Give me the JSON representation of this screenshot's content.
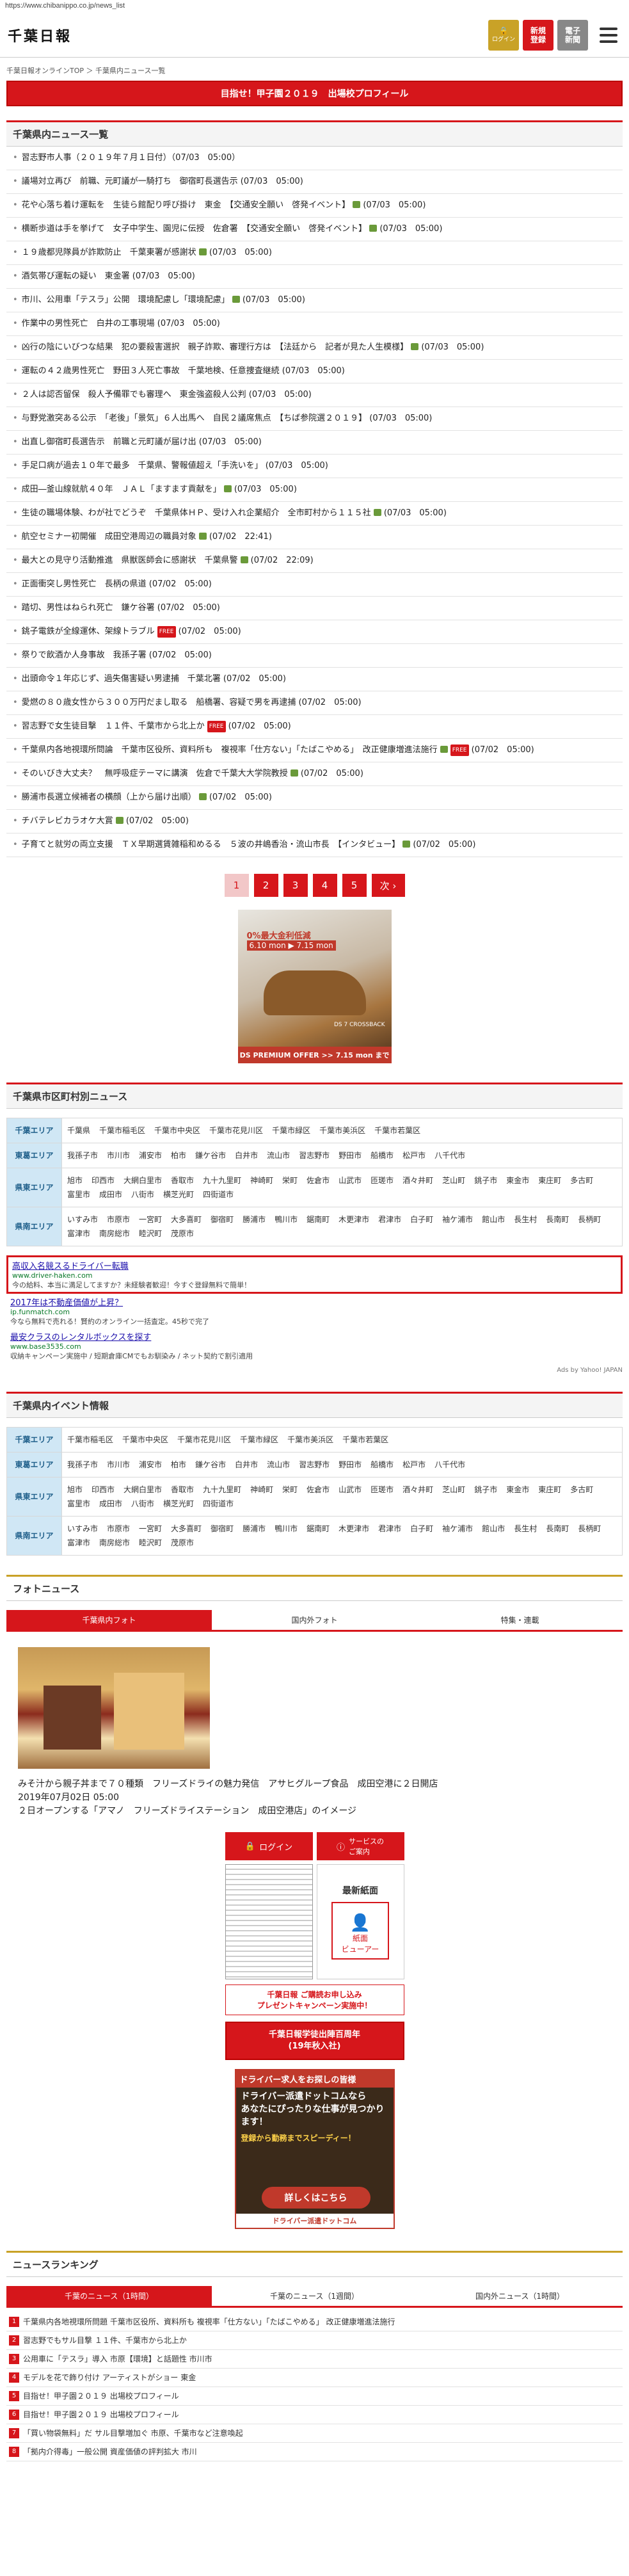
{
  "url": "https://www.chibanippo.co.jp/news_list",
  "header": {
    "logo": "千葉日報",
    "login_label": "ログイン",
    "register_label": "新規\n登録",
    "paper_label": "電子\n新聞",
    "menu_icon": "hamburger-icon"
  },
  "breadcrumb": "千葉日報オンラインTOP ＞ 千葉県内ニュース一覧",
  "banner": "目指せ！甲子園２０１９　出場校プロフィール",
  "news_section_title": "千葉県内ニュース一覧",
  "news": [
    {
      "text": "習志野市人事（２０１９年７月１日付）（07/03　05:00）",
      "cam": false,
      "free": false
    },
    {
      "text": "議場対立再び　前職、元町議が一騎打ち　御宿町長選告示 (07/03　05:00)",
      "cam": false,
      "free": false
    },
    {
      "text": "花や心落ち着け運転を　生徒ら館配り呼び掛け　東金　【交通安全願い　啓発イベント】",
      "cam": true,
      "free": false,
      "tail": "(07/03　05:00)"
    },
    {
      "text": "横断歩道は手を挙げて　女子中学生、園児に伝授　佐倉署　【交通安全願い　啓発イベント】",
      "cam": true,
      "free": false,
      "tail": "(07/03　05:00)"
    },
    {
      "text": "１９歳都児隊員が詐欺防止　千葉東署が感謝状",
      "cam": true,
      "free": false,
      "tail": "(07/03　05:00)"
    },
    {
      "text": "酒気帯び運転の疑い　東金署 (07/03　05:00)",
      "cam": false,
      "free": false
    },
    {
      "text": "市川、公用車「テスラ」公開　環境配慮し「環境配慮」",
      "cam": true,
      "free": false,
      "tail": "(07/03　05:00)"
    },
    {
      "text": "作業中の男性死亡　白井の工事現場 (07/03　05:00)",
      "cam": false,
      "free": false
    },
    {
      "text": "凶行の陰にいびつな結果　犯の要殺害選択　親子詐欺、審理行方は　【法廷から　記者が見た人生模様】",
      "cam": true,
      "free": false,
      "tail": "(07/03　05:00)"
    },
    {
      "text": "運転の４２歳男性死亡　野田３人死亡事故　千葉地検、任意捜査継続 (07/03　05:00)",
      "cam": false,
      "free": false
    },
    {
      "text": "２人は認否留保　殺人予備罪でも審理へ　東金強盗殺人公判 (07/03　05:00)",
      "cam": false,
      "free": false
    },
    {
      "text": "与野党激突ある公示　「老後」「景気」６人出馬へ　自民２議席焦点　【ちば参院選２０１９】 (07/03　05:00)",
      "cam": false,
      "free": false
    },
    {
      "text": "出直し御宿町長選告示　前職と元町議が届け出 (07/03　05:00)",
      "cam": false,
      "free": false
    },
    {
      "text": "手足口病が過去１０年で最多　千葉県、警報値超え「手洗いを」 (07/03　05:00)",
      "cam": false,
      "free": false
    },
    {
      "text": "成田―釜山線就航４０年　ＪＡＬ「ますます貢献を」",
      "cam": true,
      "free": false,
      "tail": "(07/03　05:00)"
    },
    {
      "text": "生徒の職場体験、わが社でどうぞ　千葉県体ＨＰ、受け入れ企業紹介　全市町村から１１５社",
      "cam": true,
      "free": false,
      "tail": "(07/03　05:00)"
    },
    {
      "text": "航空セミナー初開催　成田空港周辺の職員対象",
      "cam": true,
      "free": false,
      "tail": "(07/02　22:41)"
    },
    {
      "text": "最大との見守り活動推進　県獣医師会に感謝状　千葉県警",
      "cam": true,
      "free": false,
      "tail": "(07/02　22:09)"
    },
    {
      "text": "正面衝突し男性死亡　長柄の県道 (07/02　05:00)",
      "cam": false,
      "free": false
    },
    {
      "text": "踏切、男性はねられ死亡　鎌ケ谷署 (07/02　05:00)",
      "cam": false,
      "free": false
    },
    {
      "text": "銚子電鉄が全線運休、架線トラブル",
      "cam": false,
      "free": true,
      "tail": "(07/02　05:00)"
    },
    {
      "text": "祭りで飲酒か人身事故　我孫子署 (07/02　05:00)",
      "cam": false,
      "free": false
    },
    {
      "text": "出頭命令１年応じず、過失傷害疑い男逮捕　千葉北署 (07/02　05:00)",
      "cam": false,
      "free": false
    },
    {
      "text": "愛燃の８０歳女性から３００万円だまし取る　船橋署、容疑で男を再逮捕 (07/02　05:00)",
      "cam": false,
      "free": false
    },
    {
      "text": "習志野で女生徒目撃　１１件、千葉市から北上か",
      "cam": false,
      "free": true,
      "tail": "(07/02　05:00)"
    },
    {
      "text": "千葉県内各地視環所問論　千葉市区役所、資料所も　複視率「仕方ない」「たばこやめる」　改正健康増進法施行",
      "cam": true,
      "free": true,
      "tail": "(07/02　05:00)"
    },
    {
      "text": "そのいびき大丈夫？　無呼吸症テーマに講演　佐倉で千葉大大学院教授",
      "cam": true,
      "free": false,
      "tail": "(07/02　05:00)"
    },
    {
      "text": "勝浦市長選立候補者の横顔（上から届け出順）",
      "cam": true,
      "free": false,
      "tail": "(07/02　05:00)"
    },
    {
      "text": "チバテレビカラオケ大賞",
      "cam": true,
      "free": false,
      "tail": "(07/02　05:00)"
    },
    {
      "text": "子育てと就労の両立支援　ＴＸ早期選賃雑稲和めるる　５波の井嶋香治・流山市長　【インタビュー】",
      "cam": true,
      "free": false,
      "tail": "(07/02　05:00)"
    }
  ],
  "pager": {
    "pages": [
      "1",
      "2",
      "3",
      "4",
      "5"
    ],
    "next": "次 ›"
  },
  "ad1": {
    "headline": "0%最大金利低減",
    "dates": "6.10 mon ▶ 7.15 mon",
    "footer": "DS PREMIUM OFFER >> 7.15 mon まで",
    "model": "DS 7 CROSSBACK"
  },
  "area_section_title": "千葉県市区町村別ニュース",
  "areas": [
    {
      "label": "千葉エリア",
      "cities": [
        "千葉県",
        "千葉市稲毛区",
        "千葉市中央区",
        "千葉市花見川区",
        "千葉市緑区",
        "千葉市美浜区",
        "千葉市若葉区"
      ]
    },
    {
      "label": "東葛エリア",
      "cities": [
        "我孫子市",
        "市川市",
        "浦安市",
        "柏市",
        "鎌ケ谷市",
        "白井市",
        "流山市",
        "習志野市",
        "野田市",
        "船橋市",
        "松戸市",
        "八千代市"
      ]
    },
    {
      "label": "県東エリア",
      "cities": [
        "旭市",
        "印西市",
        "大網白里市",
        "香取市",
        "九十九里町",
        "神崎町",
        "栄町",
        "佐倉市",
        "山武市",
        "匝瑳市",
        "酒々井町",
        "芝山町",
        "銚子市",
        "東金市",
        "東庄町",
        "多古町",
        "富里市",
        "成田市",
        "八街市",
        "横芝光町",
        "四街道市"
      ]
    },
    {
      "label": "県南エリア",
      "cities": [
        "いすみ市",
        "市原市",
        "一宮町",
        "大多喜町",
        "御宿町",
        "勝浦市",
        "鴨川市",
        "鋸南町",
        "木更津市",
        "君津市",
        "白子町",
        "袖ケ浦市",
        "館山市",
        "長生村",
        "長南町",
        "長柄町",
        "富津市",
        "南房総市",
        "睦沢町",
        "茂原市"
      ]
    }
  ],
  "text_ads": [
    {
      "title": "高収入名競スるドライバー転職",
      "url": "www.driver-haken.com",
      "desc": "今の給料、本当に満足してますか？未経験者歓迎！今すぐ登録無料で簡単！",
      "highlight": true
    },
    {
      "title": "2017年は不動産価値が上昇？",
      "url": "ip.funmatch.com",
      "desc": "今なら無料で売れる！賢約のオンライン一括査定。45秒で完了",
      "highlight": false
    },
    {
      "title": "最安クラスのレンタルボックスを探す",
      "url": "www.base3535.com",
      "desc": "収納キャンペーン実施中 / 短期倉庫CMでもお馴染み / ネット契約で割引適用",
      "highlight": false
    }
  ],
  "ads_by": "Ads by Yahoo! JAPAN",
  "event_section_title": "千葉県内イベント情報",
  "events": [
    {
      "label": "千葉エリア",
      "cities": [
        "千葉市稲毛区",
        "千葉市中央区",
        "千葉市花見川区",
        "千葉市緑区",
        "千葉市美浜区",
        "千葉市若葉区"
      ]
    },
    {
      "label": "東葛エリア",
      "cities": [
        "我孫子市",
        "市川市",
        "浦安市",
        "柏市",
        "鎌ケ谷市",
        "白井市",
        "流山市",
        "習志野市",
        "野田市",
        "船橋市",
        "松戸市",
        "八千代市"
      ]
    },
    {
      "label": "県東エリア",
      "cities": [
        "旭市",
        "印西市",
        "大網白里市",
        "香取市",
        "九十九里町",
        "神崎町",
        "栄町",
        "佐倉市",
        "山武市",
        "匝瑳市",
        "酒々井町",
        "芝山町",
        "銚子市",
        "東金市",
        "東庄町",
        "多古町",
        "富里市",
        "成田市",
        "八街市",
        "横芝光町",
        "四街道市"
      ]
    },
    {
      "label": "県南エリア",
      "cities": [
        "いすみ市",
        "市原市",
        "一宮町",
        "大多喜町",
        "御宿町",
        "勝浦市",
        "鴨川市",
        "鋸南町",
        "木更津市",
        "君津市",
        "白子町",
        "袖ケ浦市",
        "館山市",
        "長生村",
        "長南町",
        "長柄町",
        "富津市",
        "南房総市",
        "睦沢町",
        "茂原市"
      ]
    }
  ],
  "photo_section_title": "フォトニュース",
  "photo_tabs": [
    "千葉県内フォト",
    "国内外フォト",
    "特集・連載"
  ],
  "photo_caption": "みそ汁から親子丼まで７０種類　フリーズドライの魅力発信　アサヒグループ食品　成田空港に２日開店\n2019年07月02日 05:00\n２日オープンする「アマノ　フリーズドライステーション　成田空港店」のイメージ",
  "widget": {
    "login": "ログイン",
    "service": "サービスの\nご案内",
    "latest": "最新紙面",
    "viewer": "紙面\nビューアー",
    "trial": "千葉日報 ご購読お申し込み\nプレゼントキャンペーン実施中！",
    "yearbook": "千葉日報学徒出陣百周年\n(19年秋入社)"
  },
  "driver_ad": {
    "top": "ドライバー求人をお探しの皆様",
    "main": "ドライバー派遣ドットコムなら\nあなたにぴったりな仕事が見つかります！",
    "sub": "登録から勤務までスピーディー！",
    "btn": "詳しくはこちら",
    "foot": "ドライバー派遣ドットコム"
  },
  "rank_section_title": "ニュースランキング",
  "rank_tabs": [
    "千葉のニュース（1時間）",
    "千葉のニュース（1週間）",
    "国内外ニュース（1時間）"
  ],
  "ranking": [
    "千葉県内各地視環所問題 千葉市区役所、資料所も 複視率「仕方ない」「たばこやめる」 改正健康増進法施行",
    "習志野でもサル目撃 １１件、千葉市から北上か",
    "公用車に「テスラ」導入 市原【環境】と話題性 市川市",
    "モデルを花で飾り付け アーティストがショー 東金",
    "目指せ！甲子園２０１９ 出場校プロフィール",
    "目指せ！甲子園２０１９ 出場校プロフィール",
    "「買い物袋無料」だ サル目撃増加ぐ 市原、千葉市など注意喚起",
    "「拠内介得毒」一般公開 資産価値の評判拡大 市川"
  ]
}
